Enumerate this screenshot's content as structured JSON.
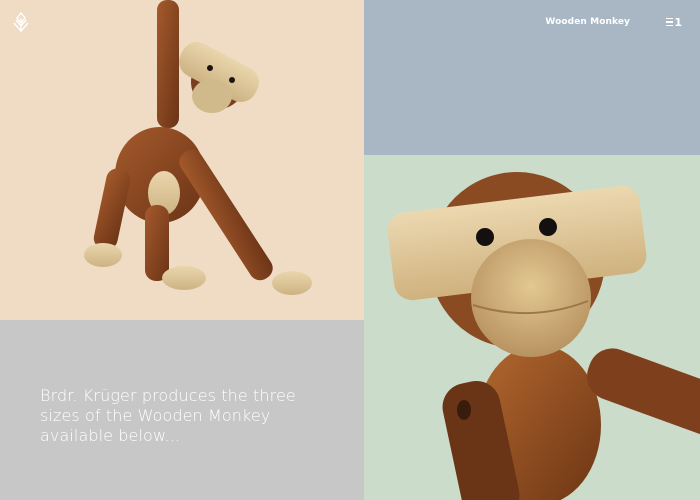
{
  "header": {
    "title": "Wooden Monkey",
    "menu_count": "1",
    "logo_icon": "diamond-leaf-logo-icon",
    "menu_icon": "hamburger-menu-icon"
  },
  "intro": {
    "text": "Brdr. Krüger produces the three sizes of the Wooden Monkey available below..."
  },
  "colors": {
    "panel_peach": "#f0dcc5",
    "panel_slate": "#a9b7c5",
    "panel_grey": "#c7c7c7",
    "panel_sage": "#cbdcca",
    "wood_dark": "#7a3f1f",
    "wood_oak": "#dcc393"
  }
}
